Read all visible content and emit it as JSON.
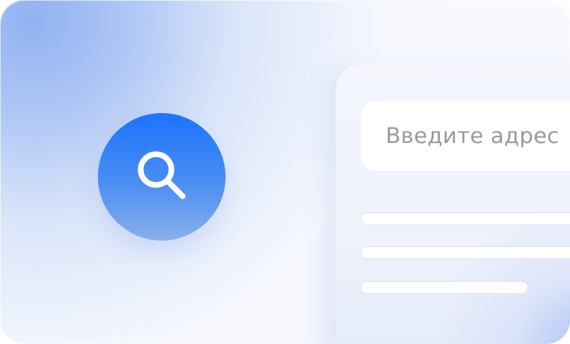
{
  "hero": {
    "icon": "search-icon",
    "colors": {
      "badge_top": "#1d73ff",
      "badge_bottom": "#89b0ea",
      "icon": "#ffffff",
      "panel": "#f4f6fc",
      "placeholder": "#9a9a9a"
    }
  },
  "browser_card": {
    "address_bar": {
      "placeholder": "Введите адрес"
    },
    "content_lines": [
      {},
      {},
      {}
    ]
  }
}
